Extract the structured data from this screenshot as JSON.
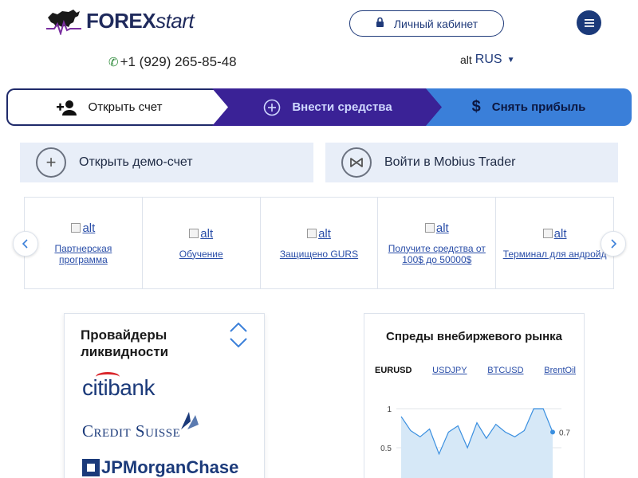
{
  "header": {
    "logo_bold": "FOREX",
    "logo_italic": "start",
    "phone": "+1 (929) 265-85-48",
    "cabinet_label": "Личный кабинет",
    "lang_alt": "alt",
    "lang_label": "RUS"
  },
  "actions": {
    "open_account": "Открыть счет",
    "deposit": "Внести средства",
    "withdraw": "Снять прибыль"
  },
  "panels": {
    "demo": "Открыть демо-счет",
    "mobius": "Войти в Mobius Trader"
  },
  "features": [
    {
      "alt": "alt",
      "label": "Партнерская программа"
    },
    {
      "alt": "alt",
      "label": "Обучение"
    },
    {
      "alt": "alt",
      "label": "Защищено GURS"
    },
    {
      "alt": "alt",
      "label": "Получите средства от 100$ до 50000$"
    },
    {
      "alt": "alt",
      "label": "Терминал для андройд"
    }
  ],
  "providers": {
    "title": "Провайдеры ликвидности",
    "logos": [
      "citibank",
      "Credit Suisse",
      "JPMorganChase"
    ]
  },
  "spreads": {
    "title": "Спреды внебиржевого рынка",
    "tabs": [
      "EURUSD",
      "USDJPY",
      "BTCUSD",
      "BrentOil"
    ],
    "active_tab": "EURUSD"
  },
  "chart_data": {
    "type": "area",
    "title": "",
    "xlabel": "",
    "ylabel": "",
    "yticks": [
      "1",
      "0.5"
    ],
    "ylim": [
      0.2,
      1.1
    ],
    "values": [
      0.9,
      0.72,
      0.64,
      0.74,
      0.42,
      0.7,
      0.78,
      0.5,
      0.82,
      0.62,
      0.8,
      0.7,
      0.64,
      0.72,
      1.0,
      1.0,
      0.7
    ],
    "last_label": "0.7",
    "colors": {
      "line": "#3a8fe0",
      "fill": "#d6e8f7"
    }
  }
}
